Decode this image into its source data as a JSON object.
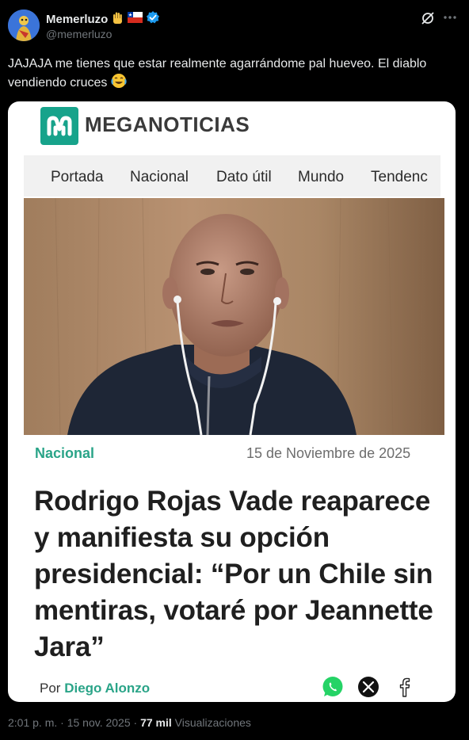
{
  "author": {
    "display_name": "Memerluzo",
    "handle": "@memerluzo"
  },
  "tweet": {
    "text": "JAJAJA me tienes que estar realmente agarrándome pal hueveo. El diablo vendiendo cruces"
  },
  "article": {
    "brand": "MEGANOTICIAS",
    "nav": [
      "Portada",
      "Nacional",
      "Dato útil",
      "Mundo",
      "Tendenc"
    ],
    "category": "Nacional",
    "date": "15 de Noviembre de 2025",
    "headline": "Rodrigo Rojas Vade reaparece y manifiesta su opción presidencial: “Por un Chile sin mentiras, votaré por Jeannette Jara”",
    "by_prefix": "Por",
    "by_name": "Diego Alonzo"
  },
  "meta": {
    "timestamp": "2:01 p. m. · 15 nov. 2025 ·",
    "views_count": "77 mil",
    "views_label": "Visualizaciones"
  },
  "colors": {
    "brand_green": "#17a38b",
    "verified_blue": "#1d9bf0"
  },
  "icons": [
    "raised-hand-emoji",
    "chile-flag",
    "verified-badge",
    "grok-icon",
    "more-icon",
    "laughing-emoji",
    "whatsapp-icon",
    "x-icon",
    "facebook-icon"
  ]
}
